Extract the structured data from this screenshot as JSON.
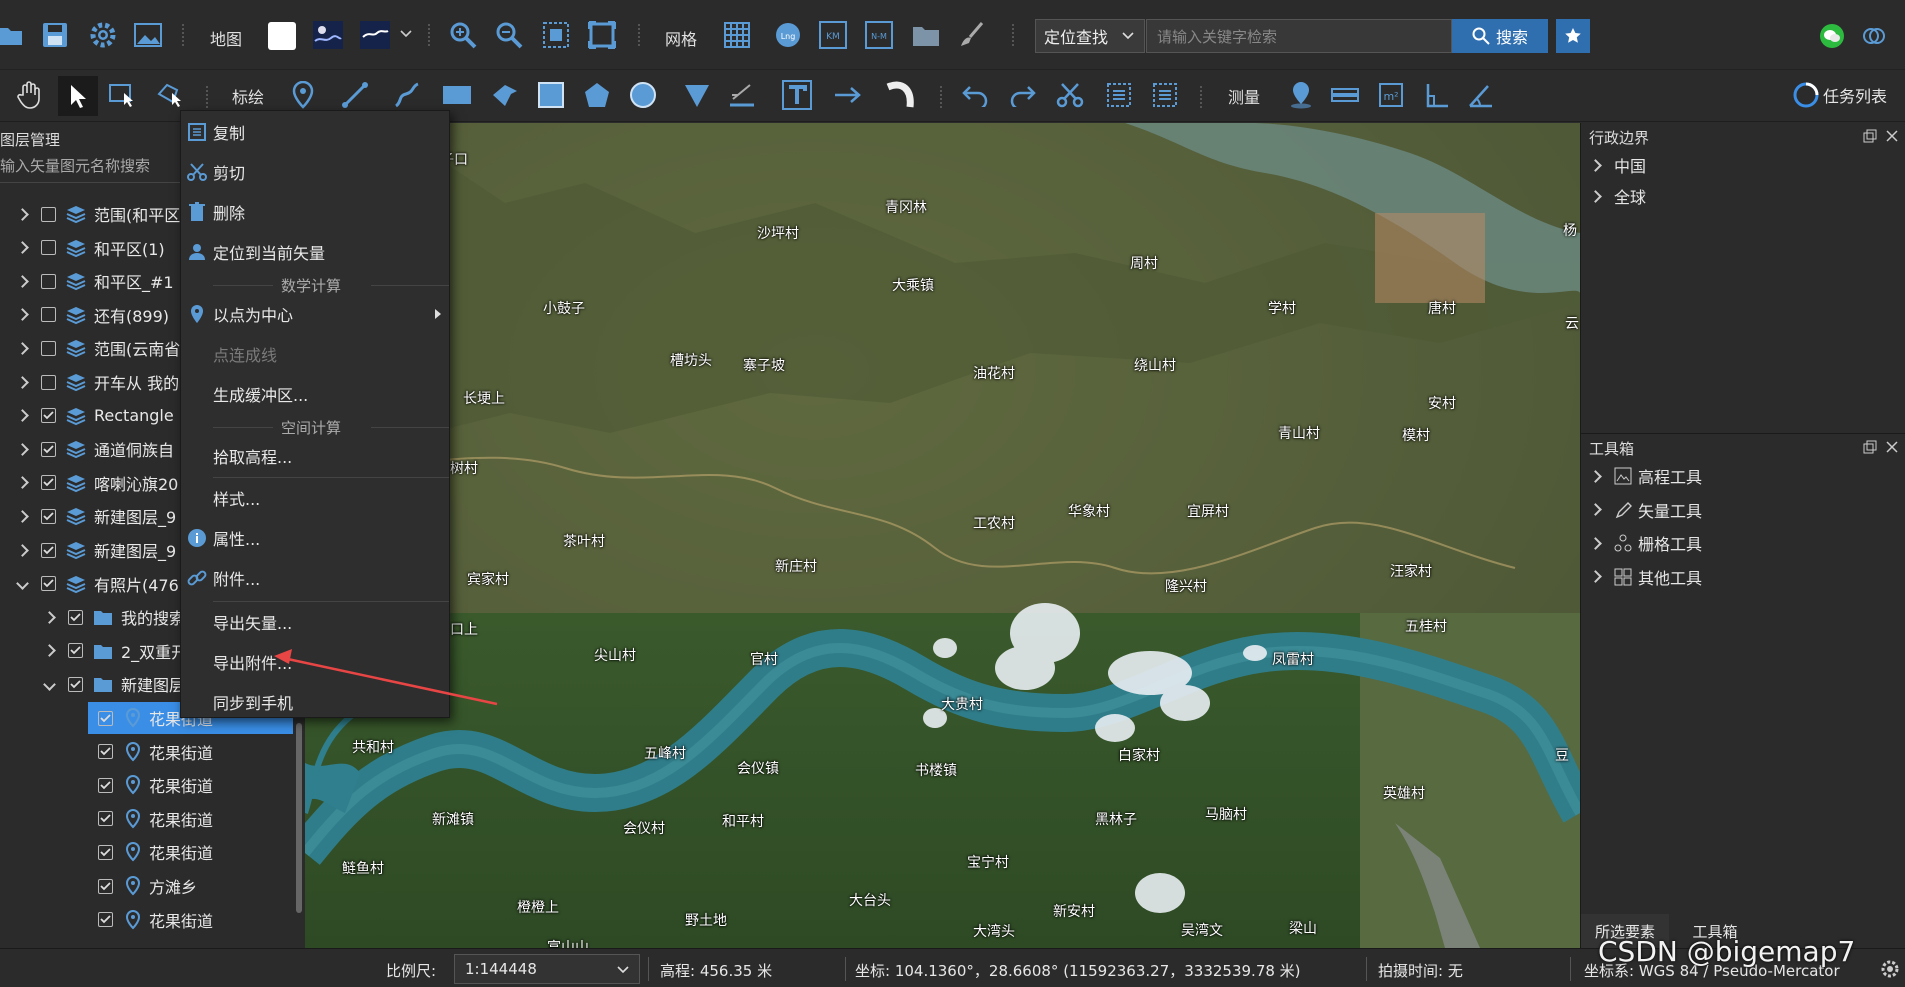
{
  "toolbar1": {
    "map_label": "地图",
    "grid_label": "网格",
    "locate_select": "定位查找",
    "search_placeholder": "请输入关键字检索",
    "search_button": "搜索"
  },
  "toolbar2": {
    "annotate_label": "标绘",
    "measure_label": "测量",
    "task_list": "任务列表"
  },
  "layer_panel": {
    "title": "图层管理",
    "search_placeholder": "输入矢量图元名称搜索",
    "rows": [
      {
        "label": "范围(和平区",
        "checked": false,
        "expanded": false
      },
      {
        "label": "和平区(1)",
        "checked": false,
        "expanded": false
      },
      {
        "label": "和平区_#1",
        "checked": false,
        "expanded": false
      },
      {
        "label": "还有(899)",
        "checked": false,
        "expanded": false
      },
      {
        "label": "范围(云南省",
        "checked": false,
        "expanded": false
      },
      {
        "label": "开车从 我的",
        "checked": false,
        "expanded": false
      },
      {
        "label": "Rectangle",
        "checked": true,
        "expanded": false
      },
      {
        "label": "通道侗族自",
        "checked": true,
        "expanded": false
      },
      {
        "label": "喀喇沁旗20",
        "checked": true,
        "expanded": false
      },
      {
        "label": "新建图层_9",
        "checked": true,
        "expanded": false
      },
      {
        "label": "新建图层_9",
        "checked": true,
        "expanded": false
      },
      {
        "label": "有照片(476",
        "checked": true,
        "expanded": true
      }
    ],
    "sub_rows": [
      {
        "label": "我的搜索",
        "checked": true,
        "expanded": false
      },
      {
        "label": "2_双重开",
        "checked": true,
        "expanded": false
      },
      {
        "label": "新建图层",
        "checked": true,
        "expanded": true
      }
    ],
    "leaf_rows": [
      {
        "label": "花果街道",
        "selected": true
      },
      {
        "label": "花果街道",
        "selected": false
      },
      {
        "label": "花果街道",
        "selected": false
      },
      {
        "label": "花果街道",
        "selected": false
      },
      {
        "label": "花果街道",
        "selected": false
      },
      {
        "label": "方滩乡",
        "selected": false
      },
      {
        "label": "花果街道",
        "selected": false
      }
    ]
  },
  "context_menu": {
    "copy": "复制",
    "cut": "剪切",
    "delete": "删除",
    "locate": "定位到当前矢量",
    "math_section": "数学计算",
    "center_point": "以点为中心",
    "connect_line": "点连成线",
    "buffer": "生成缓冲区...",
    "spatial_section": "空间计算",
    "pick_elevation": "拾取高程...",
    "style": "样式...",
    "properties": "属性...",
    "attachments": "附件...",
    "export_vector": "导出矢量...",
    "export_attachment": "导出附件...",
    "sync_phone": "同步到手机"
  },
  "map": {
    "places": [
      "子口",
      "青冈林",
      "沙坪村",
      "周村",
      "大乘镇",
      "小鼓子",
      "学村",
      "唐村",
      "槽坊头",
      "寨子坡",
      "油花村",
      "绕山村",
      "长埂上",
      "安村",
      "青山村",
      "模村",
      "树村",
      "华象村",
      "宜屏村",
      "工农村",
      "茶叶村",
      "新庄村",
      "汪家村",
      "宾家村",
      "隆兴村",
      "五桂村",
      "口上",
      "尖山村",
      "官村",
      "凤雷村",
      "大贵村",
      "共和村",
      "五峰村",
      "会仪镇",
      "书楼镇",
      "白家村",
      "英雄村",
      "新滩镇",
      "会仪村",
      "和平村",
      "黑林子",
      "马脑村",
      "鲢鱼村",
      "宝宁村",
      "大台头",
      "新安村",
      "橙橙上",
      "野土地",
      "大湾头",
      "吴湾文",
      "梁山",
      "富山山",
      "杨",
      "云",
      "豆"
    ]
  },
  "admin_panel": {
    "title": "行政边界",
    "items": [
      "中国",
      "全球"
    ]
  },
  "toolbox_panel": {
    "title": "工具箱",
    "items": [
      "高程工具",
      "矢量工具",
      "栅格工具",
      "其他工具"
    ]
  },
  "bottom_tabs": [
    "所选要素",
    "工具箱"
  ],
  "status": {
    "scale_label": "比例尺:",
    "scale_value": "1:144448",
    "elevation": "高程: 456.35 米",
    "coords": "坐标: 104.1360°，28.6608°  (11592363.27，3332539.78 米)",
    "photo_time": "拍摄时间: 无",
    "crs": "坐标系: WGS 84 / Pseudo-Mercator"
  },
  "watermark": "CSDN @bigemap7",
  "colors": {
    "selected": "#3a8ee6",
    "accent_blue": "#4a9fe8",
    "search_button": "#2f6fb0"
  }
}
